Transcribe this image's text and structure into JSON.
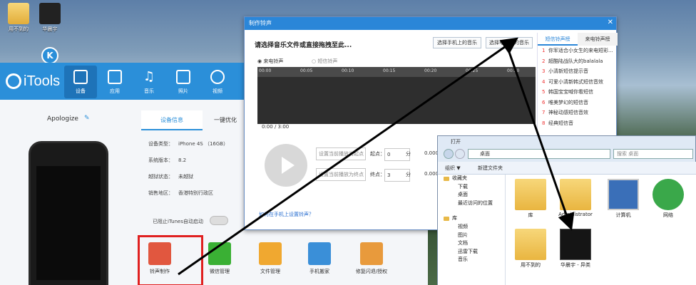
{
  "desktop": {
    "icons": [
      {
        "label": "用不到的"
      },
      {
        "label": "华晨宇"
      }
    ]
  },
  "itools": {
    "logo": "iTools",
    "nav": [
      {
        "label": "设备"
      },
      {
        "label": "应用"
      },
      {
        "label": "音乐"
      },
      {
        "label": "照片"
      },
      {
        "label": "视频"
      }
    ],
    "device_name": "Apologize",
    "tabs": [
      {
        "label": "设备信息"
      },
      {
        "label": "一键优化"
      }
    ],
    "info": [
      {
        "k": "设备类型：",
        "v": "iPhone 4S （16GB）"
      },
      {
        "k": "系统版本：",
        "v": "8.2"
      },
      {
        "k": "越狱状态：",
        "v": "未越狱"
      },
      {
        "k": "销售地区：",
        "v": "香港特别行政区"
      }
    ],
    "itunes_toggle": "已阻止iTunes自动启动",
    "tools": [
      {
        "label": "铃声制作",
        "color": "#e1573f"
      },
      {
        "label": "微信管理",
        "color": "#3ab034"
      },
      {
        "label": "文件管理",
        "color": "#f0a830"
      },
      {
        "label": "手机搬家",
        "color": "#3a8fd8"
      },
      {
        "label": "修复闪退/授权",
        "color": "#e89a3c"
      }
    ]
  },
  "ringtone": {
    "title": "制作铃声",
    "prompt": "请选择音乐文件或直接拖拽至此...",
    "btn_phone": "选择手机上的音乐",
    "btn_pc": "选择电脑上的音乐",
    "radio_call": "来电铃声",
    "radio_sms": "短信铃声",
    "ruler": [
      "00:00",
      "00:05",
      "00:10",
      "00:15",
      "00:20",
      "00:25",
      "00:30",
      "00:35"
    ],
    "time": "0:00 / 3:00",
    "set_start": "设置当前播放为起点",
    "set_end": "设置当前播放为终点",
    "start_label": "起点：",
    "start_min": "0",
    "start_sec": "0.000",
    "end_label": "终点：",
    "end_min": "3",
    "end_sec": "0.000",
    "unit_min": "分",
    "help_link": "如何在手机上设置铃声？",
    "list_tabs": [
      {
        "label": "短信铃声榜"
      },
      {
        "label": "来电铃声榜"
      }
    ],
    "list": [
      {
        "n": "1",
        "t": "你军适合小女生的来电短彩..."
      },
      {
        "n": "2",
        "t": "超酷陆战队大的balalala"
      },
      {
        "n": "3",
        "t": "小清新短信提示音"
      },
      {
        "n": "4",
        "t": "可爱小清新韩式短信音效"
      },
      {
        "n": "5",
        "t": "韩国宝宝喊你看短信"
      },
      {
        "n": "6",
        "t": "唯美梦幻的短信音"
      },
      {
        "n": "7",
        "t": "神秘动感短信音效"
      },
      {
        "n": "8",
        "t": "经典短信音"
      }
    ]
  },
  "explorer": {
    "title": "打开",
    "address": "桌面",
    "search_placeholder": "搜索 桌面",
    "organize": "组织 ▼",
    "new_folder": "新建文件夹",
    "nav": [
      {
        "label": "收藏夹"
      },
      {
        "label": "下载"
      },
      {
        "label": "桌面"
      },
      {
        "label": "最近访问的位置"
      },
      {
        "label": "库"
      },
      {
        "label": "视频"
      },
      {
        "label": "图片"
      },
      {
        "label": "文档"
      },
      {
        "label": "迅雷下载"
      },
      {
        "label": "音乐"
      }
    ],
    "files": [
      {
        "label": "库"
      },
      {
        "label": "Administrator"
      },
      {
        "label": "计算机"
      },
      {
        "label": "网络"
      },
      {
        "label": "用不到的"
      },
      {
        "label": "华晨宇 - 异类"
      }
    ]
  }
}
